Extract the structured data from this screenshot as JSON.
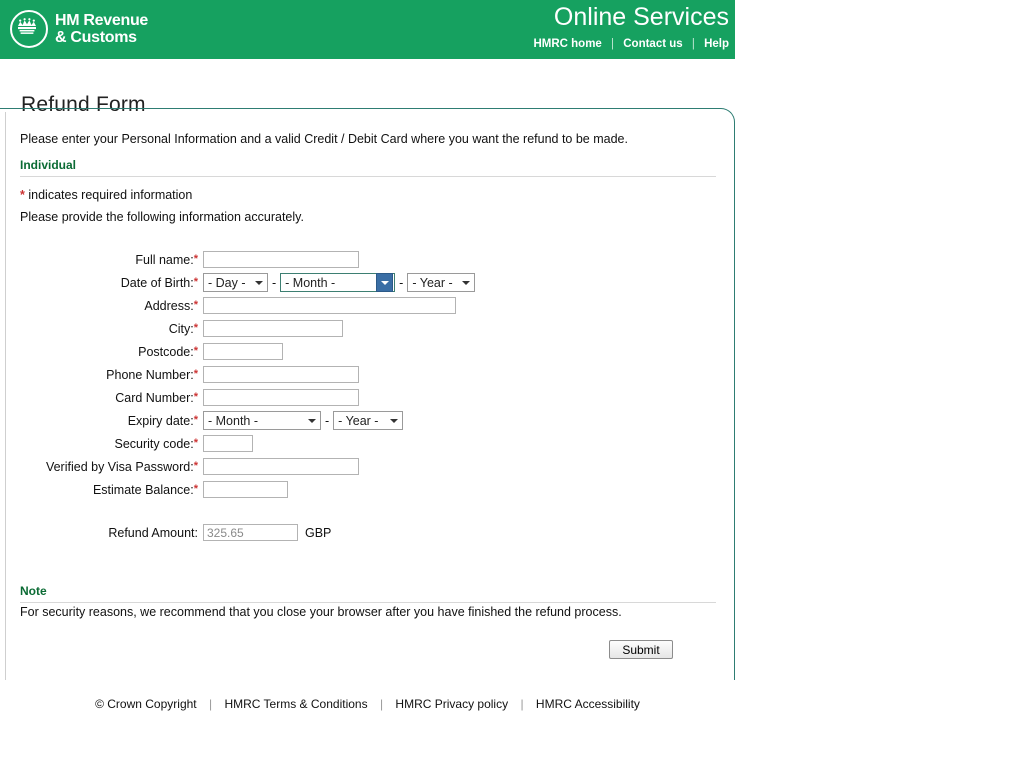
{
  "banner": {
    "logo_line1": "HM Revenue",
    "logo_line2": "& Customs",
    "title": "Online Services",
    "nav": [
      {
        "label": "HMRC home"
      },
      {
        "label": "Contact us"
      },
      {
        "label": "Help"
      }
    ],
    "separator": "|",
    "bg_color": "#16A160"
  },
  "page": {
    "title": "Refund Form",
    "intro": "Please enter your Personal Information and a valid Credit / Debit Card where you want the refund to be made.",
    "section_heading": "Individual",
    "required_marker": "*",
    "required_note": "indicates required information",
    "accurate_note": "Please provide the following information accurately.",
    "border_color": "#2e7d73",
    "heading_color": "#0b6b34",
    "required_color": "#cc3333"
  },
  "form": {
    "fields": [
      {
        "label": "Full name:",
        "required": true,
        "type": "text",
        "value": "",
        "placeholder": ""
      },
      {
        "label": "Date of Birth:",
        "required": true,
        "type": "date-group"
      },
      {
        "label": "Address:",
        "required": true,
        "type": "text",
        "value": "",
        "placeholder": ""
      },
      {
        "label": "City:",
        "required": true,
        "type": "text",
        "value": "",
        "placeholder": ""
      },
      {
        "label": "Postcode:",
        "required": true,
        "type": "text",
        "value": "",
        "placeholder": ""
      },
      {
        "label": "Phone Number:",
        "required": true,
        "type": "text",
        "value": "",
        "placeholder": ""
      },
      {
        "label": "Card Number:",
        "required": true,
        "type": "text",
        "value": "",
        "placeholder": ""
      },
      {
        "label": "Expiry date:",
        "required": true,
        "type": "expiry-group"
      },
      {
        "label": "Security code:",
        "required": true,
        "type": "text",
        "value": "",
        "placeholder": ""
      },
      {
        "label": "Verified by Visa Password:",
        "required": true,
        "type": "text",
        "value": "",
        "placeholder": ""
      },
      {
        "label": "Estimate Balance:",
        "required": true,
        "type": "text",
        "value": "",
        "placeholder": ""
      },
      {
        "label": "Refund Amount:",
        "required": false,
        "type": "text",
        "value": "325.65",
        "unit": "GBP"
      }
    ],
    "dob": {
      "day_selected": "- Day -",
      "month_selected": "- Month -",
      "year_selected": "- Year -",
      "month_focused": true
    },
    "expiry": {
      "month_selected": "- Month -",
      "year_selected": "- Year -"
    },
    "group_separator": "-",
    "refund_amount_value": "325.65",
    "refund_amount_unit": "GBP"
  },
  "note": {
    "heading": "Note",
    "text": "For security reasons, we recommend that you close your browser after you have finished the refund process."
  },
  "actions": {
    "submit_label": "Submit"
  },
  "footer": {
    "items": [
      {
        "label": "© Crown Copyright"
      },
      {
        "label": "HMRC Terms & Conditions"
      },
      {
        "label": "HMRC Privacy policy"
      },
      {
        "label": "HMRC Accessibility"
      }
    ],
    "separator": "|"
  }
}
